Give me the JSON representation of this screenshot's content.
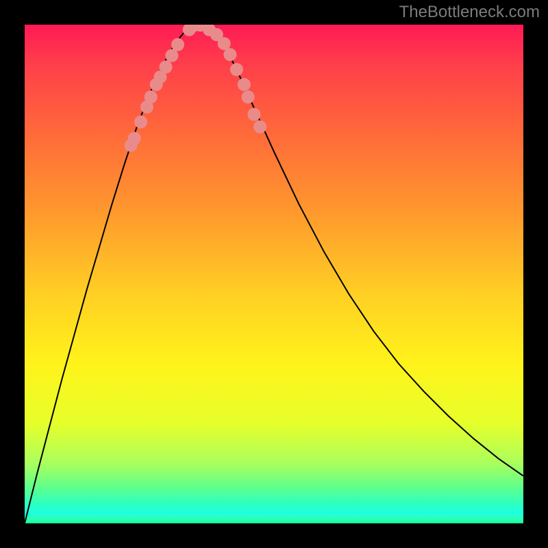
{
  "watermark": "TheBottleneck.com",
  "chart_data": {
    "type": "line",
    "title": "",
    "xlabel": "",
    "ylabel": "",
    "xlim": [
      0,
      1
    ],
    "ylim": [
      0,
      1
    ],
    "annotations": [
      "TheBottleneck.com"
    ],
    "series": [
      {
        "name": "bottleneck-curve",
        "x": [
          0.0,
          0.025,
          0.05,
          0.075,
          0.1,
          0.125,
          0.15,
          0.175,
          0.2,
          0.225,
          0.25,
          0.275,
          0.3,
          0.32,
          0.34,
          0.36,
          0.38,
          0.4,
          0.425,
          0.45,
          0.475,
          0.5,
          0.55,
          0.6,
          0.65,
          0.7,
          0.75,
          0.8,
          0.85,
          0.9,
          0.95,
          1.0
        ],
        "y": [
          0.0,
          0.1,
          0.195,
          0.29,
          0.38,
          0.47,
          0.555,
          0.64,
          0.72,
          0.795,
          0.86,
          0.915,
          0.96,
          0.985,
          0.998,
          0.998,
          0.985,
          0.96,
          0.91,
          0.855,
          0.8,
          0.745,
          0.64,
          0.545,
          0.46,
          0.385,
          0.32,
          0.265,
          0.215,
          0.17,
          0.13,
          0.095
        ]
      },
      {
        "name": "dots-left",
        "type": "scatter",
        "x": [
          0.213,
          0.22,
          0.233,
          0.245,
          0.253,
          0.264,
          0.272,
          0.283,
          0.295,
          0.307,
          0.33
        ],
        "y": [
          0.758,
          0.772,
          0.805,
          0.835,
          0.855,
          0.88,
          0.895,
          0.915,
          0.938,
          0.96,
          0.99
        ]
      },
      {
        "name": "dots-right",
        "type": "scatter",
        "x": [
          0.37,
          0.385,
          0.4,
          0.412,
          0.425,
          0.44,
          0.448,
          0.46,
          0.472
        ],
        "y": [
          0.99,
          0.98,
          0.962,
          0.94,
          0.91,
          0.88,
          0.855,
          0.82,
          0.795
        ]
      },
      {
        "name": "dots-bottom",
        "type": "scatter",
        "x": [
          0.338,
          0.352,
          0.365
        ],
        "y": [
          0.998,
          0.999,
          0.998
        ]
      }
    ],
    "background_gradient": {
      "top": "#ff1a55",
      "mid_upper": "#ff9a2d",
      "mid": "#fff31a",
      "mid_lower": "#a9ff5d",
      "bottom": "#15ff9a"
    }
  }
}
